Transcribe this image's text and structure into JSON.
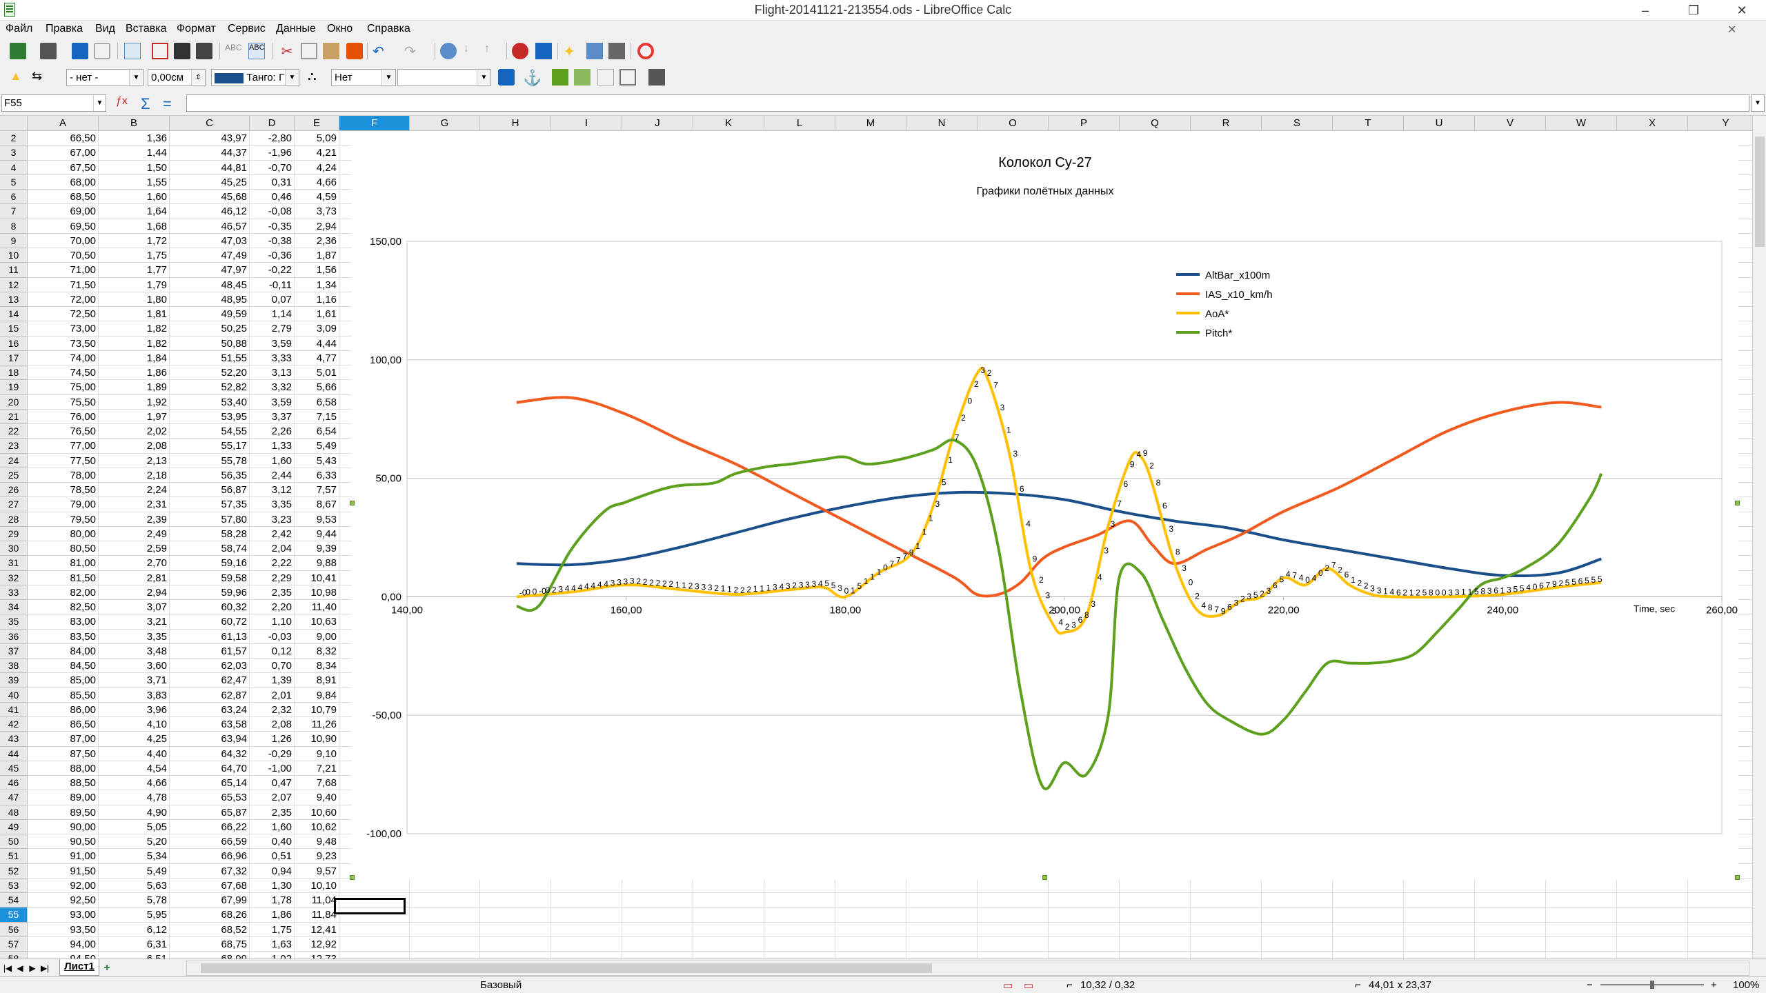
{
  "window": {
    "title": "Flight-20141121-213554.ods - LibreOffice Calc",
    "minimize": "–",
    "maximize": "❐",
    "close": "✕"
  },
  "menu": [
    "Файл",
    "Правка",
    "Вид",
    "Вставка",
    "Формат",
    "Сервис",
    "Данные",
    "Окно",
    "Справка"
  ],
  "toolbar2": {
    "anchor_combo": "- нет -",
    "width_value": "0,00см",
    "color_combo": "Танго: Г",
    "line_style": "Нет",
    "fill_combo": ""
  },
  "formula": {
    "name_box": "F55",
    "content": ""
  },
  "columns": [
    "A",
    "B",
    "C",
    "D",
    "E",
    "F",
    "G",
    "H",
    "I",
    "J",
    "K",
    "L",
    "M",
    "N",
    "O",
    "P",
    "Q",
    "R",
    "S",
    "T",
    "U",
    "V",
    "W",
    "X",
    "Y"
  ],
  "selected_column": "F",
  "selected_row": "55",
  "rows": [
    [
      "2",
      "66,50",
      "1,36",
      "43,97",
      "-2,80",
      "5,09"
    ],
    [
      "3",
      "67,00",
      "1,44",
      "44,37",
      "-1,96",
      "4,21"
    ],
    [
      "4",
      "67,50",
      "1,50",
      "44,81",
      "-0,70",
      "4,24"
    ],
    [
      "5",
      "68,00",
      "1,55",
      "45,25",
      "0,31",
      "4,66"
    ],
    [
      "6",
      "68,50",
      "1,60",
      "45,68",
      "0,46",
      "4,59"
    ],
    [
      "7",
      "69,00",
      "1,64",
      "46,12",
      "-0,08",
      "3,73"
    ],
    [
      "8",
      "69,50",
      "1,68",
      "46,57",
      "-0,35",
      "2,94"
    ],
    [
      "9",
      "70,00",
      "1,72",
      "47,03",
      "-0,38",
      "2,36"
    ],
    [
      "10",
      "70,50",
      "1,75",
      "47,49",
      "-0,36",
      "1,87"
    ],
    [
      "11",
      "71,00",
      "1,77",
      "47,97",
      "-0,22",
      "1,56"
    ],
    [
      "12",
      "71,50",
      "1,79",
      "48,45",
      "-0,11",
      "1,34"
    ],
    [
      "13",
      "72,00",
      "1,80",
      "48,95",
      "0,07",
      "1,16"
    ],
    [
      "14",
      "72,50",
      "1,81",
      "49,59",
      "1,14",
      "1,61"
    ],
    [
      "15",
      "73,00",
      "1,82",
      "50,25",
      "2,79",
      "3,09"
    ],
    [
      "16",
      "73,50",
      "1,82",
      "50,88",
      "3,59",
      "4,44"
    ],
    [
      "17",
      "74,00",
      "1,84",
      "51,55",
      "3,33",
      "4,77"
    ],
    [
      "18",
      "74,50",
      "1,86",
      "52,20",
      "3,13",
      "5,01"
    ],
    [
      "19",
      "75,00",
      "1,89",
      "52,82",
      "3,32",
      "5,66"
    ],
    [
      "20",
      "75,50",
      "1,92",
      "53,40",
      "3,59",
      "6,58"
    ],
    [
      "21",
      "76,00",
      "1,97",
      "53,95",
      "3,37",
      "7,15"
    ],
    [
      "22",
      "76,50",
      "2,02",
      "54,55",
      "2,26",
      "6,54"
    ],
    [
      "23",
      "77,00",
      "2,08",
      "55,17",
      "1,33",
      "5,49"
    ],
    [
      "24",
      "77,50",
      "2,13",
      "55,78",
      "1,60",
      "5,43"
    ],
    [
      "25",
      "78,00",
      "2,18",
      "56,35",
      "2,44",
      "6,33"
    ],
    [
      "26",
      "78,50",
      "2,24",
      "56,87",
      "3,12",
      "7,57"
    ],
    [
      "27",
      "79,00",
      "2,31",
      "57,35",
      "3,35",
      "8,67"
    ],
    [
      "28",
      "79,50",
      "2,39",
      "57,80",
      "3,23",
      "9,53"
    ],
    [
      "29",
      "80,00",
      "2,49",
      "58,28",
      "2,42",
      "9,44"
    ],
    [
      "30",
      "80,50",
      "2,59",
      "58,74",
      "2,04",
      "9,39"
    ],
    [
      "31",
      "81,00",
      "2,70",
      "59,16",
      "2,22",
      "9,88"
    ],
    [
      "32",
      "81,50",
      "2,81",
      "59,58",
      "2,29",
      "10,41"
    ],
    [
      "33",
      "82,00",
      "2,94",
      "59,96",
      "2,35",
      "10,98"
    ],
    [
      "34",
      "82,50",
      "3,07",
      "60,32",
      "2,20",
      "11,40"
    ],
    [
      "35",
      "83,00",
      "3,21",
      "60,72",
      "1,10",
      "10,63"
    ],
    [
      "36",
      "83,50",
      "3,35",
      "61,13",
      "-0,03",
      "9,00"
    ],
    [
      "37",
      "84,00",
      "3,48",
      "61,57",
      "0,12",
      "8,32"
    ],
    [
      "38",
      "84,50",
      "3,60",
      "62,03",
      "0,70",
      "8,34"
    ],
    [
      "39",
      "85,00",
      "3,71",
      "62,47",
      "1,39",
      "8,91"
    ],
    [
      "40",
      "85,50",
      "3,83",
      "62,87",
      "2,01",
      "9,84"
    ],
    [
      "41",
      "86,00",
      "3,96",
      "63,24",
      "2,32",
      "10,79"
    ],
    [
      "42",
      "86,50",
      "4,10",
      "63,58",
      "2,08",
      "11,26"
    ],
    [
      "43",
      "87,00",
      "4,25",
      "63,94",
      "1,26",
      "10,90"
    ],
    [
      "44",
      "87,50",
      "4,40",
      "64,32",
      "-0,29",
      "9,10"
    ],
    [
      "45",
      "88,00",
      "4,54",
      "64,70",
      "-1,00",
      "7,21"
    ],
    [
      "46",
      "88,50",
      "4,66",
      "65,14",
      "0,47",
      "7,68"
    ],
    [
      "47",
      "89,00",
      "4,78",
      "65,53",
      "2,07",
      "9,40"
    ],
    [
      "48",
      "89,50",
      "4,90",
      "65,87",
      "2,35",
      "10,60"
    ],
    [
      "49",
      "90,00",
      "5,05",
      "66,22",
      "1,60",
      "10,62"
    ],
    [
      "50",
      "90,50",
      "5,20",
      "66,59",
      "0,40",
      "9,48"
    ],
    [
      "51",
      "91,00",
      "5,34",
      "66,96",
      "0,51",
      "9,23"
    ],
    [
      "52",
      "91,50",
      "5,49",
      "67,32",
      "0,94",
      "9,57"
    ],
    [
      "53",
      "92,00",
      "5,63",
      "67,68",
      "1,30",
      "10,10"
    ],
    [
      "54",
      "92,50",
      "5,78",
      "67,99",
      "1,78",
      "11,04"
    ],
    [
      "55",
      "93,00",
      "5,95",
      "68,26",
      "1,86",
      "11,84"
    ],
    [
      "56",
      "93,50",
      "6,12",
      "68,52",
      "1,75",
      "12,41"
    ],
    [
      "57",
      "94,00",
      "6,31",
      "68,75",
      "1,63",
      "12,92"
    ],
    [
      "58",
      "94,50",
      "6,51",
      "68,99",
      "1,02",
      "12,73"
    ]
  ],
  "chart_data": {
    "type": "line",
    "title": "Колокол Су-27",
    "subtitle": "Графики полётных данных",
    "xlabel": "Time, sec",
    "xlim": [
      140,
      260
    ],
    "ylim": [
      -100,
      150
    ],
    "x_ticks": [
      "140,00",
      "160,00",
      "180,00",
      "200,00",
      "220,00",
      "240,00",
      "260,00"
    ],
    "y_ticks": [
      "150,00",
      "100,00",
      "50,00",
      "0,00",
      "-50,00",
      "-100,00"
    ],
    "grid": "horizontal",
    "legend_position": "top-right",
    "series": [
      {
        "name": "AltBar_x100m",
        "color": "#1a4f8a",
        "x": [
          150,
          155,
          160,
          165,
          170,
          175,
          180,
          185,
          190,
          195,
          200,
          205,
          210,
          215,
          220,
          225,
          230,
          235,
          240,
          245,
          249
        ],
        "y": [
          14,
          13.5,
          16,
          21,
          27,
          33,
          38,
          42,
          44,
          43.5,
          41,
          36,
          32,
          29,
          24,
          20,
          16,
          12,
          9,
          10,
          16
        ]
      },
      {
        "name": "IAS_x10_km/h",
        "color": "#f05a1e",
        "x": [
          150,
          155,
          160,
          165,
          170,
          175,
          180,
          185,
          190,
          192,
          194,
          196,
          198,
          200,
          203,
          206,
          208,
          210,
          213,
          216,
          220,
          225,
          230,
          235,
          240,
          245,
          249
        ],
        "y": [
          82,
          84,
          77,
          66,
          56,
          44,
          32,
          20,
          8,
          1,
          1,
          6,
          16,
          21,
          26,
          32,
          22,
          14,
          20,
          26,
          36,
          46,
          58,
          70,
          78,
          82,
          80
        ]
      },
      {
        "name": "AoA*",
        "color": "#ffc000",
        "x": [
          150,
          155,
          160,
          165,
          170,
          175,
          178,
          180,
          183,
          186,
          188,
          190,
          192,
          193,
          195,
          197,
          199,
          200,
          202,
          204,
          206,
          207,
          208,
          210,
          212,
          214,
          216,
          218,
          220,
          222,
          224,
          226,
          228,
          230,
          235,
          240,
          245,
          249
        ],
        "y": [
          0,
          2,
          5,
          3,
          1,
          3,
          4,
          0,
          10,
          18,
          38,
          70,
          94,
          92,
          60,
          10,
          -12,
          -15,
          -8,
          30,
          58,
          59,
          48,
          15,
          -5,
          -8,
          -2,
          0,
          8,
          5,
          12,
          5,
          1,
          0,
          0,
          1,
          4,
          6
        ]
      },
      {
        "name": "Pitch*",
        "color": "#5ca01e",
        "x": [
          150,
          152,
          155,
          158,
          160,
          163,
          165,
          168,
          170,
          173,
          175,
          178,
          180,
          182,
          185,
          188,
          190,
          192,
          194,
          196,
          198,
          200,
          202,
          204,
          205,
          207,
          209,
          211,
          213,
          215,
          218,
          220,
          222,
          224,
          226,
          228,
          230,
          232,
          234,
          236,
          238,
          240,
          242,
          245,
          248,
          249
        ],
        "y": [
          -4,
          -4,
          20,
          36,
          40,
          45,
          47,
          48,
          52,
          55,
          56,
          58,
          59,
          56,
          58,
          62,
          66,
          55,
          20,
          -40,
          -80,
          -70,
          -75,
          -50,
          8,
          10,
          -10,
          -30,
          -45,
          -52,
          -58,
          -52,
          -40,
          -28,
          -28,
          -28,
          -27,
          -24,
          -15,
          -5,
          5,
          8,
          12,
          22,
          42,
          52
        ]
      }
    ]
  },
  "chart_point_labels": {
    "aoa": [
      "-0",
      "0",
      "0",
      "-0",
      "0",
      "2",
      "3",
      "4",
      "4",
      "4",
      "4",
      "4",
      "4",
      "4",
      "3",
      "3",
      "3",
      "3",
      "2",
      "2",
      "2",
      "2",
      "2",
      "2",
      "1",
      "1",
      "2",
      "3",
      "3",
      "3",
      "2",
      "1",
      "1",
      "2",
      "2",
      "2",
      "1",
      "1",
      "1",
      "3",
      "4",
      "3",
      "2",
      "3",
      "3",
      "3",
      "4",
      "5",
      "5",
      "3",
      "0",
      "1",
      "5",
      "1",
      "1",
      "1",
      "0",
      "7",
      "7",
      "7",
      "9",
      "1",
      "1",
      "1",
      "3",
      "5",
      "1",
      "7",
      "2",
      "0",
      "2",
      "3",
      "2",
      "7",
      "3",
      "1",
      "3",
      "6",
      "4",
      "9",
      "2",
      "3",
      "5",
      "4",
      "2",
      "3",
      "6",
      "8",
      "3",
      "4",
      "3",
      "3",
      "7",
      "6",
      "9",
      "4",
      "9",
      "2",
      "8",
      "6",
      "3",
      "8",
      "3",
      "0",
      "2",
      "4",
      "8",
      "7",
      "9",
      "6",
      "3",
      "2",
      "3",
      "5",
      "2",
      "3",
      "6",
      "5",
      "4",
      "7",
      "4",
      "0",
      "4",
      "0",
      "2",
      "7",
      "2",
      "6",
      "1",
      "2",
      "2",
      "3",
      "3",
      "1",
      "4",
      "6",
      "2",
      "1",
      "2",
      "5",
      "8",
      "0",
      "0",
      "3",
      "3",
      "1",
      "1",
      "5",
      "8",
      "3",
      "6",
      "1",
      "3",
      "5",
      "5",
      "4",
      "0",
      "6",
      "7",
      "9",
      "2",
      "5",
      "5",
      "6",
      "5",
      "5",
      "5"
    ]
  },
  "sheet": {
    "tab": "Лист1",
    "add": "+"
  },
  "status": {
    "style": "Базовый",
    "position": "10,32 / 0,32",
    "size": "44,01 x 23,37",
    "zoom": "100%"
  }
}
